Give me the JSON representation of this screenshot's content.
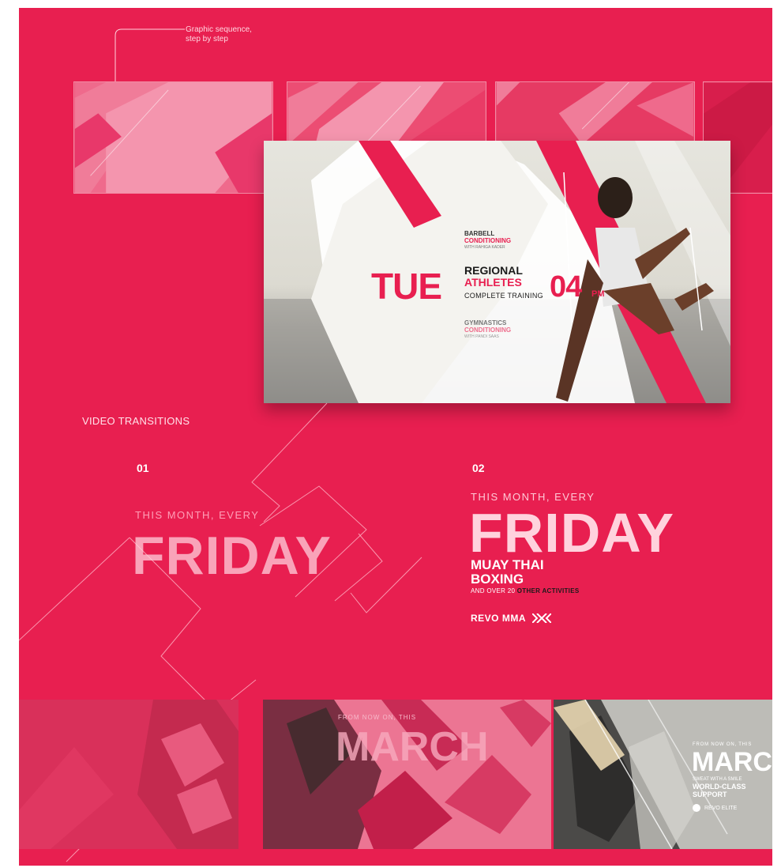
{
  "callout": {
    "line1": "Graphic sequence,",
    "line2": "step by step"
  },
  "hero": {
    "day": "TUE",
    "top_class": {
      "line1": "BARBELL",
      "line2": "CONDITIONING",
      "line3": "WITH RAHIGA KADER"
    },
    "main": {
      "line1": "REGIONAL",
      "line2": "ATHLETES",
      "line3": "COMPLETE TRAINING"
    },
    "time": "04",
    "ampm": "PM",
    "bottom_class": {
      "line1": "GYMNASTICS",
      "line2": "CONDITIONING",
      "line3": "WITH PANDI SAAS"
    }
  },
  "section_title": "VIDEO TRANSITIONS",
  "transition1": {
    "number": "01",
    "label": "THIS MONTH, EVERY",
    "big": "FRIDAY"
  },
  "transition2": {
    "number": "02",
    "label": "THIS MONTH, EVERY",
    "big": "FRIDAY",
    "sub1": "MUAY THAI",
    "sub2": "BOXING",
    "note_prefix": "AND OVER 20",
    "note_highlight": "OTHER ACTIVITIES",
    "brand": "REVO MMA"
  },
  "thumb2": {
    "label": "FROM NOW ON, THIS",
    "big": "MARCH"
  },
  "thumb3": {
    "label": "FROM NOW ON, THIS",
    "big": "MARC",
    "line1": "SWEAT WITH A SMILE",
    "line2": "WORLD-CLASS",
    "line3": "SUPPORT",
    "brand": "REVO ELITE"
  },
  "colors": {
    "brand_red": "#e81f50",
    "light_pink": "#ee6f8e",
    "dark_text": "#1a1a1a"
  }
}
